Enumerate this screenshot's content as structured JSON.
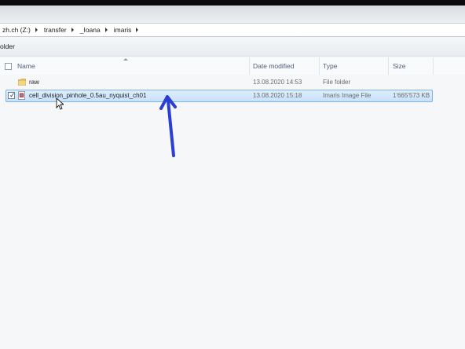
{
  "address": {
    "crumbs": [
      "zh.ch (Z:)",
      "transfer",
      "_Ioana",
      "imaris"
    ]
  },
  "toolbar": {
    "new_folder_partial": "older"
  },
  "columns": {
    "name": "Name",
    "date": "Date modified",
    "type": "Type",
    "size": "Size"
  },
  "files": [
    {
      "name": "raw",
      "date": "13.08.2020 14:53",
      "type": "File folder",
      "size": "",
      "icon": "folder-icon",
      "selected": false
    },
    {
      "name": "cell_division_pinhole_0.5au_nyquist_ch01",
      "date": "13.08.2020 15:18",
      "type": "Imaris Image File",
      "size": "1'665'573 KB",
      "icon": "imaris-file-icon",
      "selected": true
    }
  ],
  "colors": {
    "selection_fill": "#cfe5fb",
    "selection_border": "#7fb2e6",
    "annotation_arrow": "#2a3fd3",
    "folder": "#e8c25a"
  }
}
